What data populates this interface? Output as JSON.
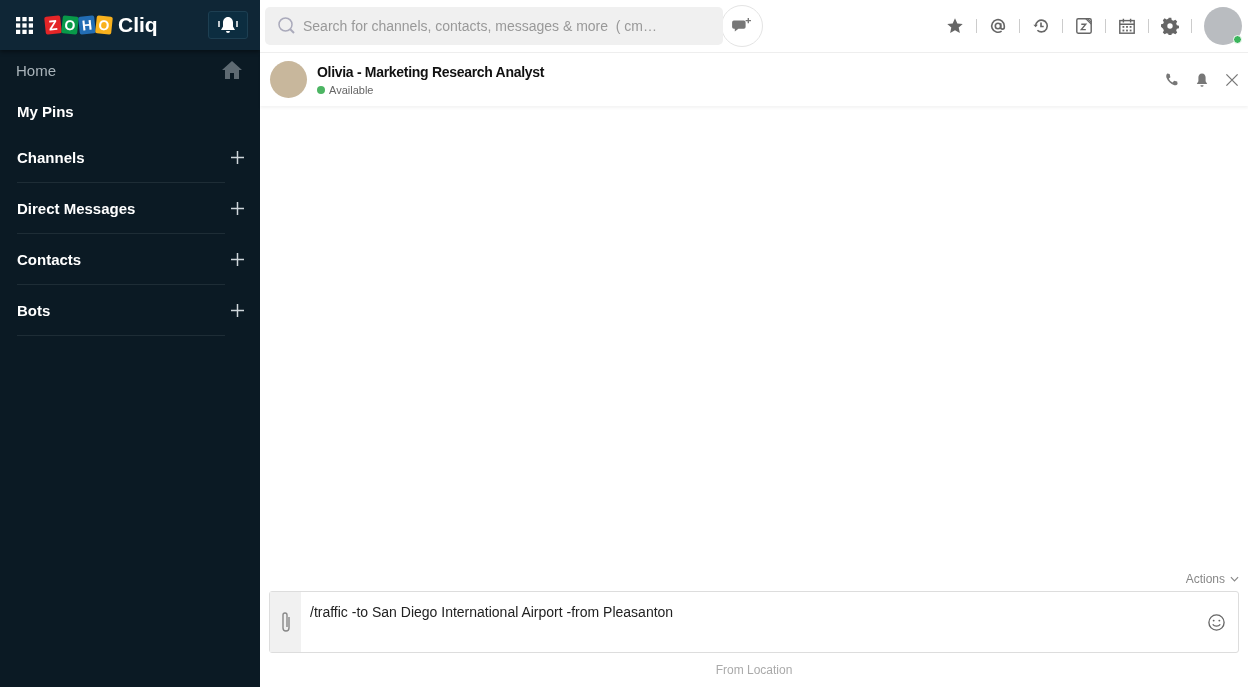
{
  "app": {
    "logo_tiles": [
      {
        "letter": "Z",
        "color": "#e42527"
      },
      {
        "letter": "O",
        "color": "#089949"
      },
      {
        "letter": "H",
        "color": "#226db4"
      },
      {
        "letter": "O",
        "color": "#f9b21d"
      }
    ],
    "logo_text": "Cliq"
  },
  "sidebar": {
    "items": [
      {
        "label": "Home",
        "kind": "home"
      },
      {
        "label": "My Pins",
        "kind": "plain"
      },
      {
        "label": "Channels",
        "kind": "add"
      },
      {
        "label": "Direct Messages",
        "kind": "add"
      },
      {
        "label": "Contacts",
        "kind": "add"
      },
      {
        "label": "Bots",
        "kind": "add"
      }
    ]
  },
  "search": {
    "placeholder": "Search for channels, contacts, messages & more  ( cm…"
  },
  "chat": {
    "name": "Olivia - Marketing Research Analyst",
    "status": "Available"
  },
  "composer": {
    "actions_label": "Actions",
    "value": "/traffic -to San Diego International Airport -from Pleasanton",
    "hint": "From Location"
  }
}
